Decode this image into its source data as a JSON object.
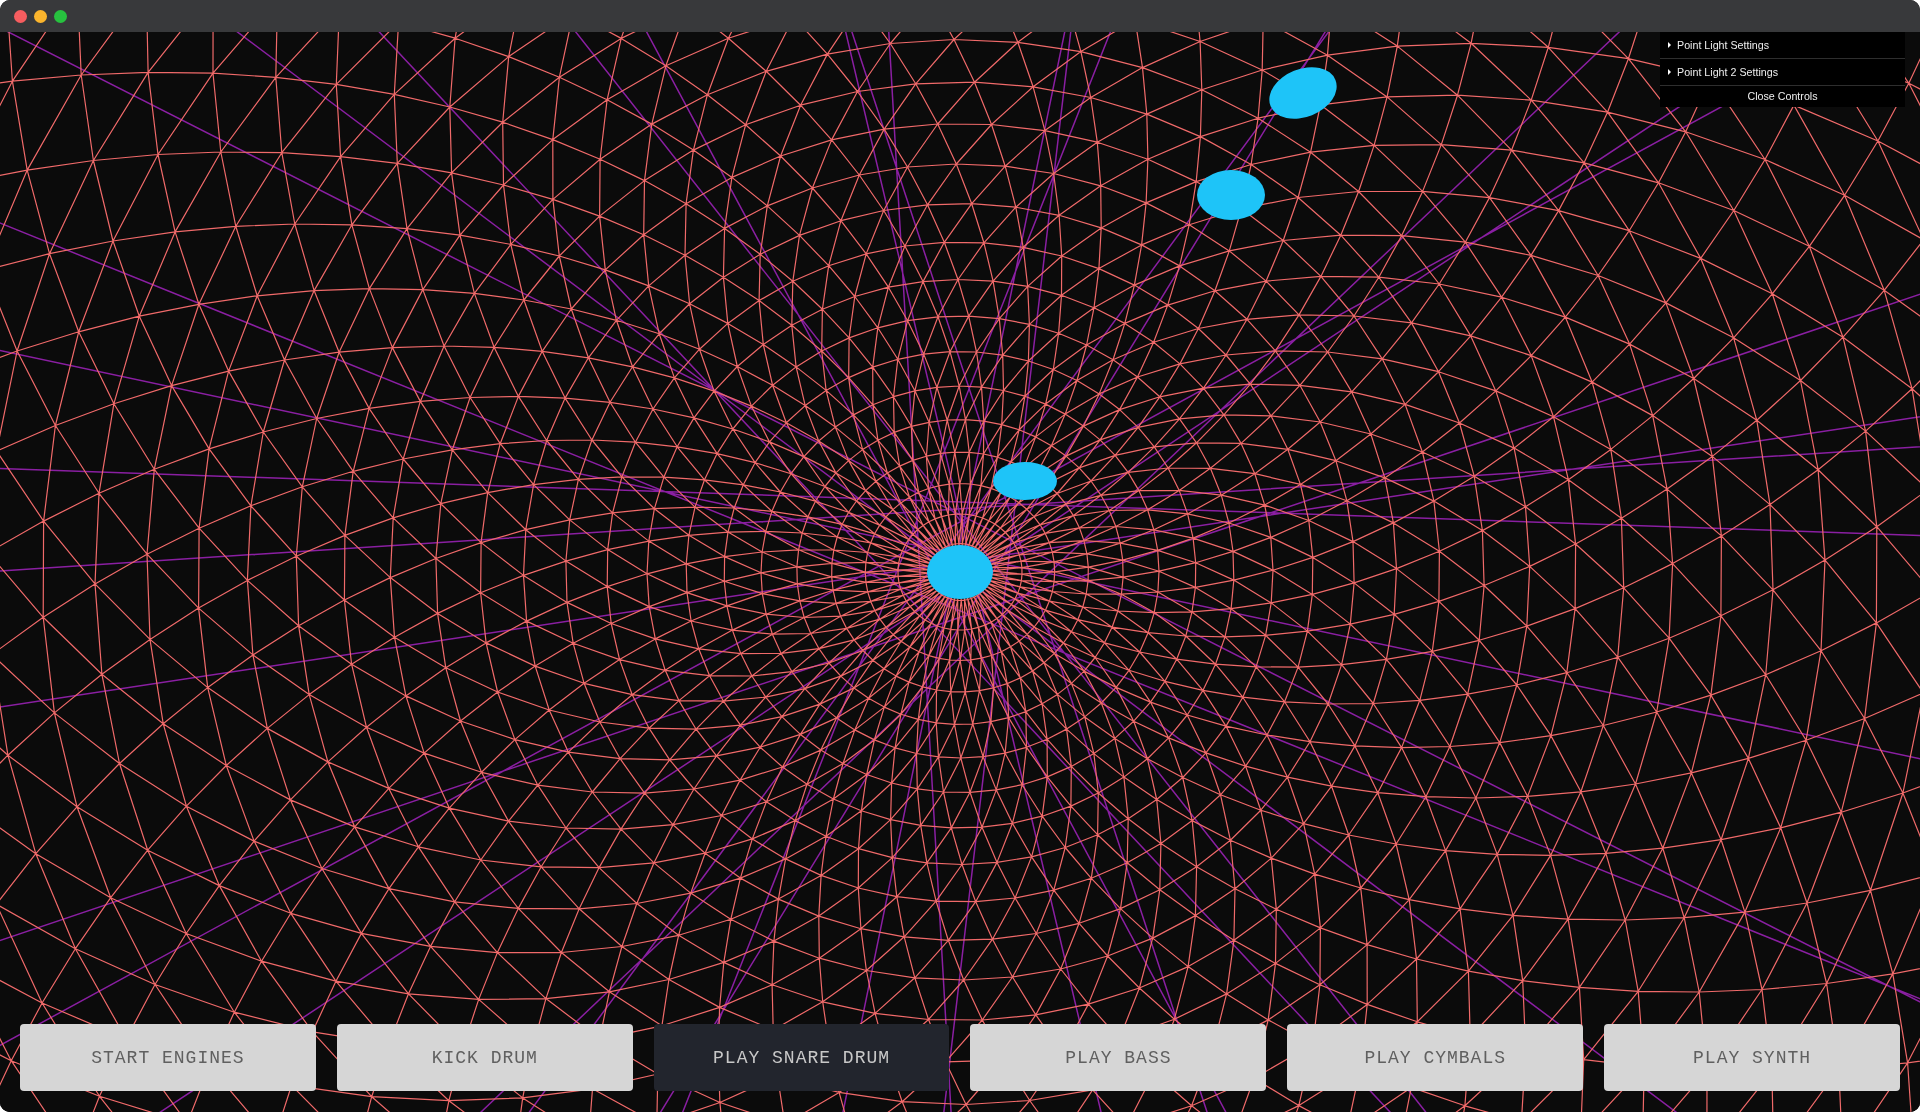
{
  "window": {
    "buttons": [
      {
        "kind": "close",
        "color": "#f65d5f"
      },
      {
        "kind": "minimize",
        "color": "#fbb52d"
      },
      {
        "kind": "zoom",
        "color": "#27c23f"
      }
    ]
  },
  "controls_panel": {
    "folders": [
      {
        "title": "Point Light Settings",
        "expanded": false
      },
      {
        "title": "Point Light 2 Settings",
        "expanded": false
      }
    ],
    "close_label": "Close Controls"
  },
  "buttons": [
    {
      "label": "START ENGINES",
      "active": false
    },
    {
      "label": "KICK DRUM",
      "active": false
    },
    {
      "label": "PLAY SNARE DRUM",
      "active": true
    },
    {
      "label": "PLAY BASS",
      "active": false
    },
    {
      "label": "PLAY CYMBALS",
      "active": false
    },
    {
      "label": "PLAY SYNTH",
      "active": false
    }
  ]
}
